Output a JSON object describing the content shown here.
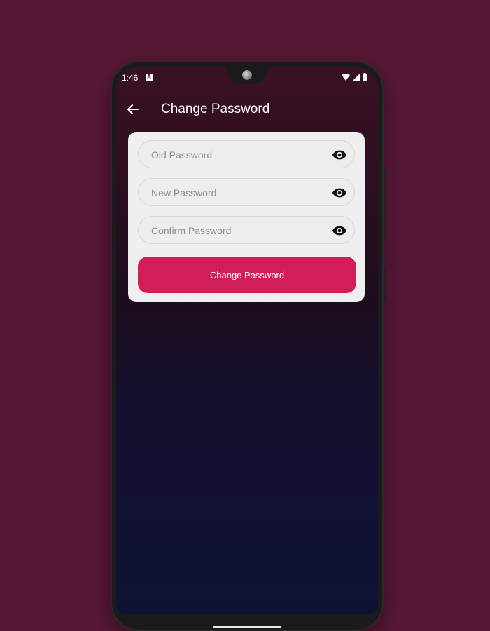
{
  "status_bar": {
    "time": "1:46",
    "notification_letter": "A"
  },
  "app_bar": {
    "title": "Change Password"
  },
  "form": {
    "old_password": {
      "value": "",
      "placeholder": "Old Password"
    },
    "new_password": {
      "value": "",
      "placeholder": "New Password"
    },
    "confirm_password": {
      "value": "",
      "placeholder": "Confirm Password"
    },
    "submit_label": "Change Password"
  },
  "icons": {
    "back": "arrow-left-icon",
    "toggle_visibility": "eye-icon"
  },
  "colors": {
    "page_background": "#561835",
    "accent": "#d11e57",
    "card": "#efefef"
  }
}
